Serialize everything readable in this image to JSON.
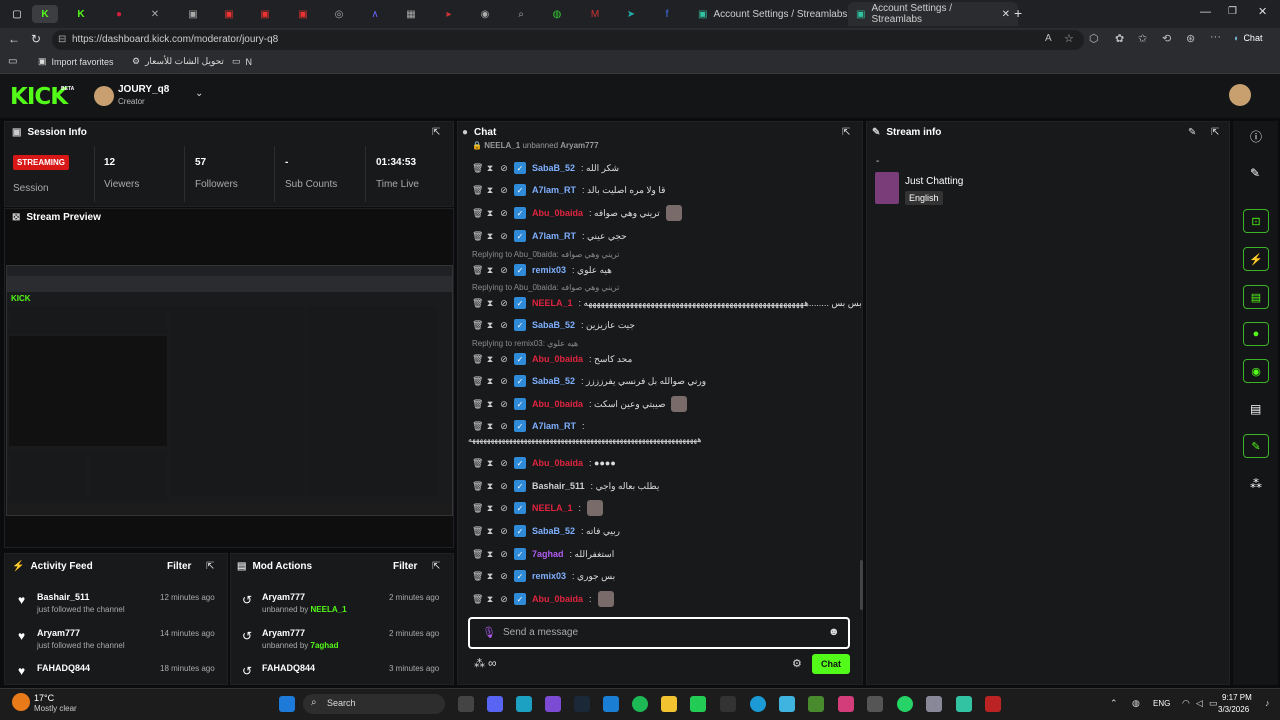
{
  "browser": {
    "tabs": [
      {
        "title": "Account Settings / Streamlabs"
      },
      {
        "title": "Account Settings / Streamlabs"
      }
    ],
    "url": "https://dashboard.kick.com/moderator/joury-q8",
    "copilot_label": "Chat",
    "bookmarks": [
      {
        "label": "Import favorites"
      },
      {
        "label": "تحويل الشات للأسعار"
      },
      {
        "label": "N"
      }
    ]
  },
  "header": {
    "logo": "KICK",
    "beta": "BETA",
    "channel": "JOURY_q8",
    "role": "Creator"
  },
  "session": {
    "title": "Session Info",
    "status": "STREAMING",
    "stats": [
      {
        "value": "",
        "label": "Session"
      },
      {
        "value": "12",
        "label": "Viewers"
      },
      {
        "value": "57",
        "label": "Followers"
      },
      {
        "value": "-",
        "label": "Sub Counts"
      },
      {
        "value": "01:34:53",
        "label": "Time Live"
      }
    ]
  },
  "preview": {
    "title": "Stream Preview"
  },
  "chat": {
    "title": "Chat",
    "top_notice_user": "NEELA_1",
    "top_notice_text": "unbanned",
    "top_notice_target": "Aryam777",
    "messages": [
      {
        "user": "SabaB_52",
        "text": "شكر الله",
        "color": "#7fb0ff"
      },
      {
        "user": "A7lam_RT",
        "text": "قا ولا مره اصليت بالد",
        "color": "#7fb0ff"
      },
      {
        "user": "Abu_0baida",
        "text": "تريني وهي صوافه",
        "color": "#e0243f",
        "emote": true
      },
      {
        "user": "A7lam_RT",
        "text": "حجي عيني",
        "color": "#7fb0ff"
      },
      {
        "reply": "Replying to Abu_0baida: تريني وهي صوافه"
      },
      {
        "user": "remix03",
        "text": "هيه علوي",
        "color": "#7fb0ff"
      },
      {
        "reply": "Replying to Abu_0baida: تريني وهي صوافه"
      },
      {
        "user": "NEELA_1",
        "text": "بس بس ........هههههههههههههههههههههههههههههههههههههههههههههههههههههه",
        "color": "#e0243f"
      },
      {
        "user": "SabaB_52",
        "text": "جيت عازيزين",
        "color": "#7fb0ff"
      },
      {
        "reply": "Replying to remix03: هيه علوي"
      },
      {
        "user": "Abu_0baida",
        "text": "محد كاسح",
        "color": "#e0243f"
      },
      {
        "user": "SabaB_52",
        "text": "ورني صوالله بل فرنسي يفرزززز",
        "color": "#7fb0ff"
      },
      {
        "user": "Abu_0baida",
        "text": "صيبتي وعين اسكت",
        "color": "#e0243f",
        "emote": true
      },
      {
        "user": "A7lam_RT",
        "text": "",
        "color": "#7fb0ff"
      },
      {
        "cont": "ههههههههههههههههههههههههههههههههههههههههههههههههههههههههههههههه"
      },
      {
        "user": "Abu_0baida",
        "text": "●●●●",
        "color": "#e0243f"
      },
      {
        "user": "Bashair_511",
        "text": "يطلب بعاله واجي",
        "color": "#cfcfcf"
      },
      {
        "user": "NEELA_1",
        "text": "",
        "color": "#e0243f",
        "emote": true
      },
      {
        "user": "SabaB_52",
        "text": "ربيي فاته",
        "color": "#7fb0ff"
      },
      {
        "user": "7aghad",
        "text": "استغفرالله",
        "color": "#b05cf0"
      },
      {
        "user": "remix03",
        "text": "بس جوري",
        "color": "#7fb0ff"
      },
      {
        "user": "Abu_0baida",
        "text": "",
        "color": "#e0243f",
        "emote": true
      }
    ],
    "input_placeholder": "Send a message",
    "send_label": "Chat"
  },
  "stream_info": {
    "title": "Stream info",
    "dash": "-",
    "category": "Just Chatting",
    "language": "English"
  },
  "activity": {
    "title": "Activity Feed",
    "filter": "Filter",
    "items": [
      {
        "name": "Bashair_511",
        "sub": "just followed the channel",
        "time": "12 minutes ago"
      },
      {
        "name": "Aryam777",
        "sub": "just followed the channel",
        "time": "14 minutes ago"
      },
      {
        "name": "FAHADQ844",
        "sub": "",
        "time": "18 minutes ago"
      }
    ]
  },
  "mod": {
    "title": "Mod Actions",
    "filter": "Filter",
    "items": [
      {
        "name": "Aryam777",
        "action": "unbanned by",
        "by": "NEELA_1",
        "by_color": "#53fc18",
        "time": "2 minutes ago"
      },
      {
        "name": "Aryam777",
        "action": "unbanned by",
        "by": "7aghad",
        "by_color": "#53fc18",
        "time": "2 minutes ago"
      },
      {
        "name": "FAHADQ844",
        "action": "",
        "by": "",
        "time": "3 minutes ago"
      }
    ]
  },
  "taskbar": {
    "weather_temp": "17°C",
    "weather_desc": "Mostly clear",
    "search": "Search",
    "lang": "ENG",
    "time": "9:17 PM",
    "date": "3/3/2026"
  }
}
